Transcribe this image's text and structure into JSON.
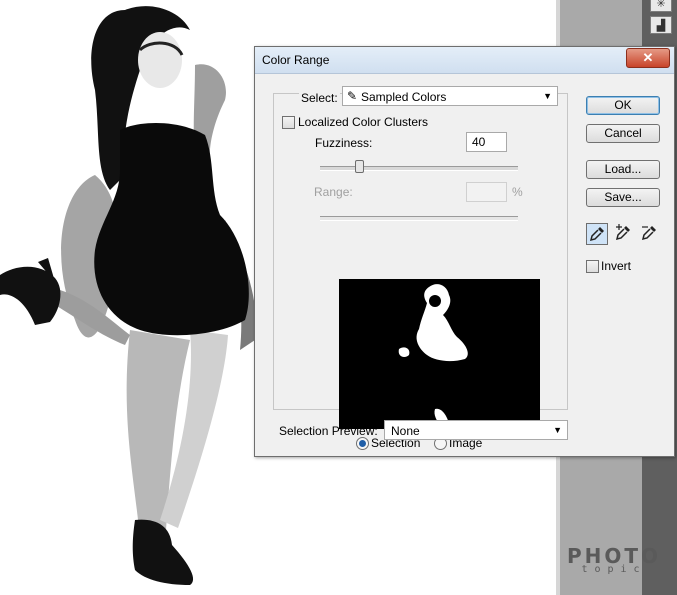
{
  "dialog": {
    "title": "Color Range",
    "close_glyph": "✕",
    "select_label": "Select:",
    "select_value": "Sampled Colors",
    "localized_label": "Localized Color Clusters",
    "localized_checked": false,
    "fuzziness_label": "Fuzziness:",
    "fuzziness_value": "40",
    "fuzziness_fraction": 0.2,
    "range_label": "Range:",
    "range_value": "",
    "range_unit": "%",
    "view_options": [
      {
        "label": "Selection",
        "selected": true
      },
      {
        "label": "Image",
        "selected": false
      }
    ],
    "preview_label": "Selection Preview:",
    "preview_value": "None",
    "buttons": {
      "ok": "OK",
      "cancel": "Cancel",
      "load": "Load...",
      "save": "Save..."
    },
    "invert_label": "Invert",
    "invert_checked": false,
    "eyedroppers": [
      "eyedropper-icon",
      "eyedropper-plus-icon",
      "eyedropper-minus-icon"
    ]
  },
  "watermark": {
    "line1": "PHOTO",
    "line2": "topic"
  },
  "colors": {
    "titlebar": "#d9e6f4",
    "close": "#c8442a",
    "accent": "#1f5ea8"
  }
}
